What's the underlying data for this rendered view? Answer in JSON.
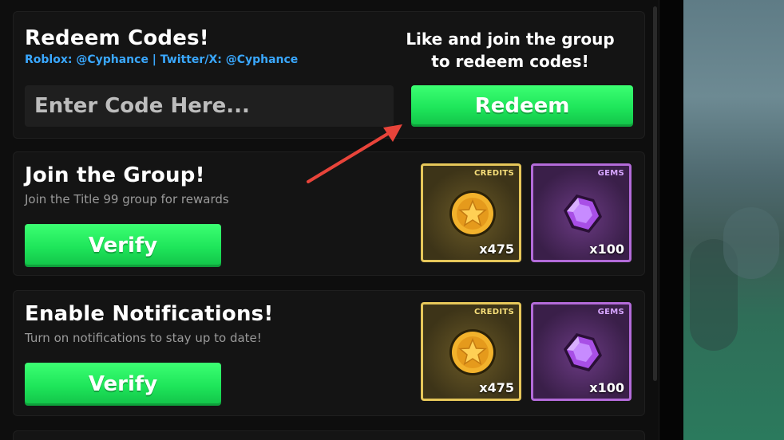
{
  "redeem": {
    "title": "Redeem Codes!",
    "social": "Roblox: @Cyphance | Twitter/X: @Cyphance",
    "hint_line1": "Like and join the group",
    "hint_line2": "to redeem codes!",
    "input_placeholder": "Enter Code Here...",
    "button_label": "Redeem"
  },
  "group": {
    "title": "Join the Group!",
    "subtitle": "Join the Title 99 group for rewards",
    "button_label": "Verify",
    "rewards": [
      {
        "tag": "CREDITS",
        "amount": "x475",
        "icon": "coin-star-icon"
      },
      {
        "tag": "GEMS",
        "amount": "x100",
        "icon": "gem-icon"
      }
    ]
  },
  "notifications": {
    "title": "Enable Notifications!",
    "subtitle": "Turn on notifications to stay up to date!",
    "button_label": "Verify",
    "rewards": [
      {
        "tag": "CREDITS",
        "amount": "x475",
        "icon": "coin-star-icon"
      },
      {
        "tag": "GEMS",
        "amount": "x100",
        "icon": "gem-icon"
      }
    ]
  },
  "colors": {
    "accent_green": "#1ee55a",
    "social_blue": "#3aa8ff",
    "credits_border": "#e6c75a",
    "gems_border": "#b36bd9",
    "annotation_arrow": "#e8443a"
  }
}
